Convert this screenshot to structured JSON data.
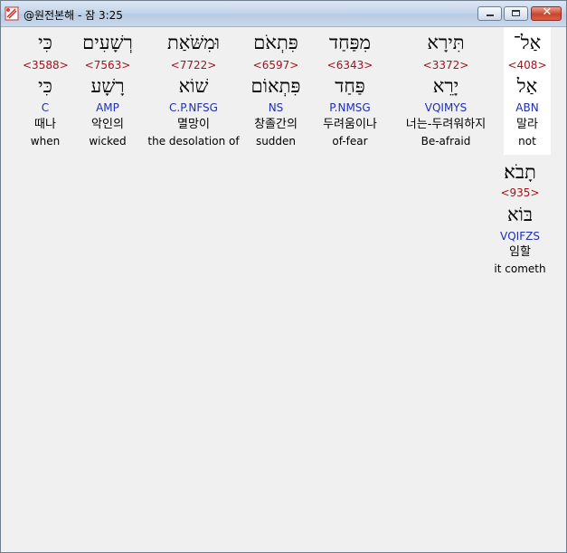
{
  "window": {
    "title": "@원전본해 - 잠 3:25"
  },
  "controls": {
    "minimize": "minimize-icon",
    "maximize": "maximize-icon",
    "close": "close-icon",
    "close_glyph": "✕"
  },
  "words": [
    {
      "hebrew": "אַל־",
      "strongs": "<408>",
      "lemma": "אַל",
      "morph": "ABN",
      "korean": "말라",
      "english": "not"
    },
    {
      "hebrew": "תִּירָא",
      "strongs": "<3372>",
      "lemma": "יָרֵא",
      "morph": "VQIMYS",
      "korean": "너는-두려워하지",
      "english": "Be-afraid"
    },
    {
      "hebrew": "מִפַּחַד",
      "strongs": "<6343>",
      "lemma": "פַּחַד",
      "morph": "P.NMSG",
      "korean": "두려움이나",
      "english": "of-fear"
    },
    {
      "hebrew": "פִּתְאֹם",
      "strongs": "<6597>",
      "lemma": "פִּתְאוֹם",
      "morph": "NS",
      "korean": "창졸간의",
      "english": "sudden"
    },
    {
      "hebrew": "וּמִשֹּׁאַת",
      "strongs": "<7722>",
      "lemma": "שׁוֹא",
      "morph": "C.P.NFSG",
      "korean": "멸망이",
      "english": "the desolation of"
    },
    {
      "hebrew": "רְשָׁעִים",
      "strongs": "<7563>",
      "lemma": "רָשָׁע",
      "morph": "AMP",
      "korean": "악인의",
      "english": "wicked"
    },
    {
      "hebrew": "כִּי",
      "strongs": "<3588>",
      "lemma": "כִּי",
      "morph": "C",
      "korean": "때나",
      "english": "when"
    },
    {
      "hebrew": "תָבֹא׃",
      "strongs": "<935>",
      "lemma": "בּוֹא",
      "morph": "VQIFZS",
      "korean": "임할",
      "english": "it cometh"
    }
  ]
}
